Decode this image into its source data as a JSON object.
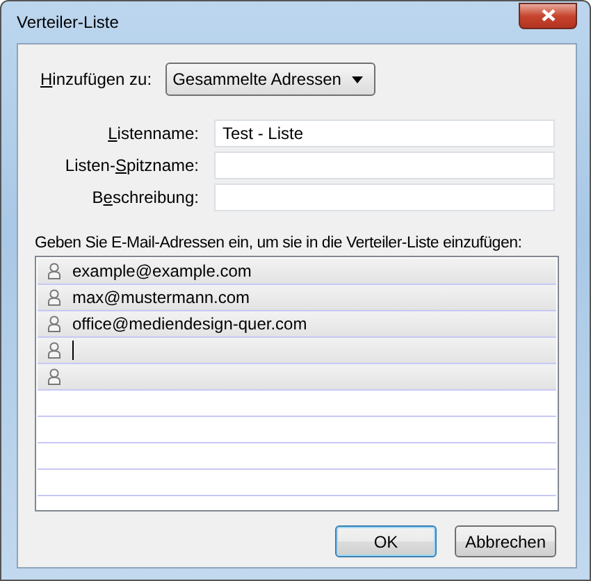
{
  "window": {
    "title": "Verteiler-Liste"
  },
  "add_to": {
    "label": [
      {
        "text": "H",
        "underlined": true
      },
      {
        "text": "inzufügen zu:",
        "underlined": false
      }
    ],
    "value": "Gesammelte Adressen"
  },
  "fields": [
    {
      "label": [
        {
          "text": "L",
          "underlined": true
        },
        {
          "text": "istenname:",
          "underlined": false
        }
      ],
      "value": "Test - Liste"
    },
    {
      "label": [
        {
          "text": "Listen-",
          "underlined": false
        },
        {
          "text": "S",
          "underlined": true
        },
        {
          "text": "pitzname:",
          "underlined": false
        }
      ]
    },
    {
      "label": [
        {
          "text": "B",
          "underlined": false
        },
        {
          "text": "e",
          "underlined": true
        },
        {
          "text": "schreibung:",
          "underlined": false
        }
      ]
    }
  ],
  "instructions": "Geben Sie E-Mail-Adressen ein, um sie in die Verteiler-Liste einzufügen:",
  "addresses": [
    {
      "value": "example@example.com",
      "focused": false
    },
    {
      "value": "max@mustermann.com",
      "focused": false
    },
    {
      "value": "office@mediendesign-quer.com",
      "focused": false
    },
    {
      "focused": true
    },
    {
      "focused": false
    }
  ],
  "buttons": [
    {
      "label": "OK",
      "default": true
    },
    {
      "label": "Abbrechen",
      "default": false
    }
  ]
}
